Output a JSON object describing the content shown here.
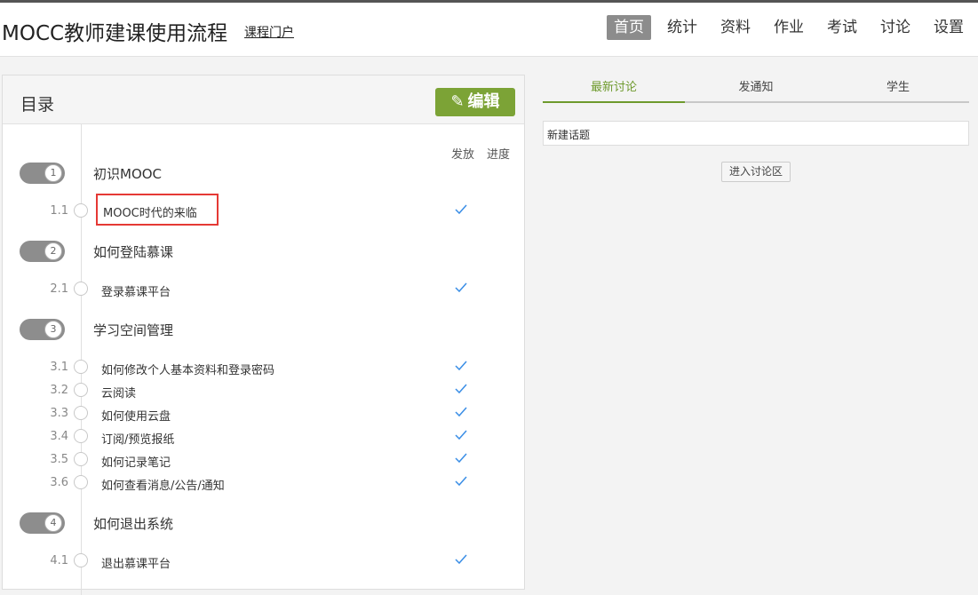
{
  "header": {
    "title": "MOCC教师建课使用流程",
    "portal_link": "课程门户",
    "nav": [
      "首页",
      "统计",
      "资料",
      "作业",
      "考试",
      "讨论",
      "设置"
    ],
    "active_nav": "首页"
  },
  "catalog": {
    "title": "目录",
    "edit_label": "编辑",
    "col_publish": "发放",
    "col_progress": "进度",
    "chapters": [
      {
        "num": "1",
        "title": "初识MOOC",
        "sections": [
          {
            "num": "1.1",
            "title": "MOOC时代的来临",
            "published": true
          }
        ]
      },
      {
        "num": "2",
        "title": "如何登陆慕课",
        "sections": [
          {
            "num": "2.1",
            "title": "登录慕课平台",
            "published": true
          }
        ]
      },
      {
        "num": "3",
        "title": "学习空间管理",
        "sections": [
          {
            "num": "3.1",
            "title": "如何修改个人基本资料和登录密码",
            "published": true
          },
          {
            "num": "3.2",
            "title": "云阅读",
            "published": true
          },
          {
            "num": "3.3",
            "title": "如何使用云盘",
            "published": true
          },
          {
            "num": "3.4",
            "title": "订阅/预览报纸",
            "published": true
          },
          {
            "num": "3.5",
            "title": "如何记录笔记",
            "published": true
          },
          {
            "num": "3.6",
            "title": "如何查看消息/公告/通知",
            "published": true
          }
        ]
      },
      {
        "num": "4",
        "title": "如何退出系统",
        "sections": [
          {
            "num": "4.1",
            "title": "退出慕课平台",
            "published": true
          }
        ]
      }
    ]
  },
  "right_panel": {
    "tabs": [
      "最新讨论",
      "发通知",
      "学生"
    ],
    "active_tab": "最新讨论",
    "new_topic_label": "新建话题",
    "enter_button": "进入讨论区"
  },
  "colors": {
    "accent_green": "#7ca336",
    "tab_green": "#6e9a2d",
    "check_blue": "#3a8ee6",
    "highlight_red": "#e53935"
  }
}
